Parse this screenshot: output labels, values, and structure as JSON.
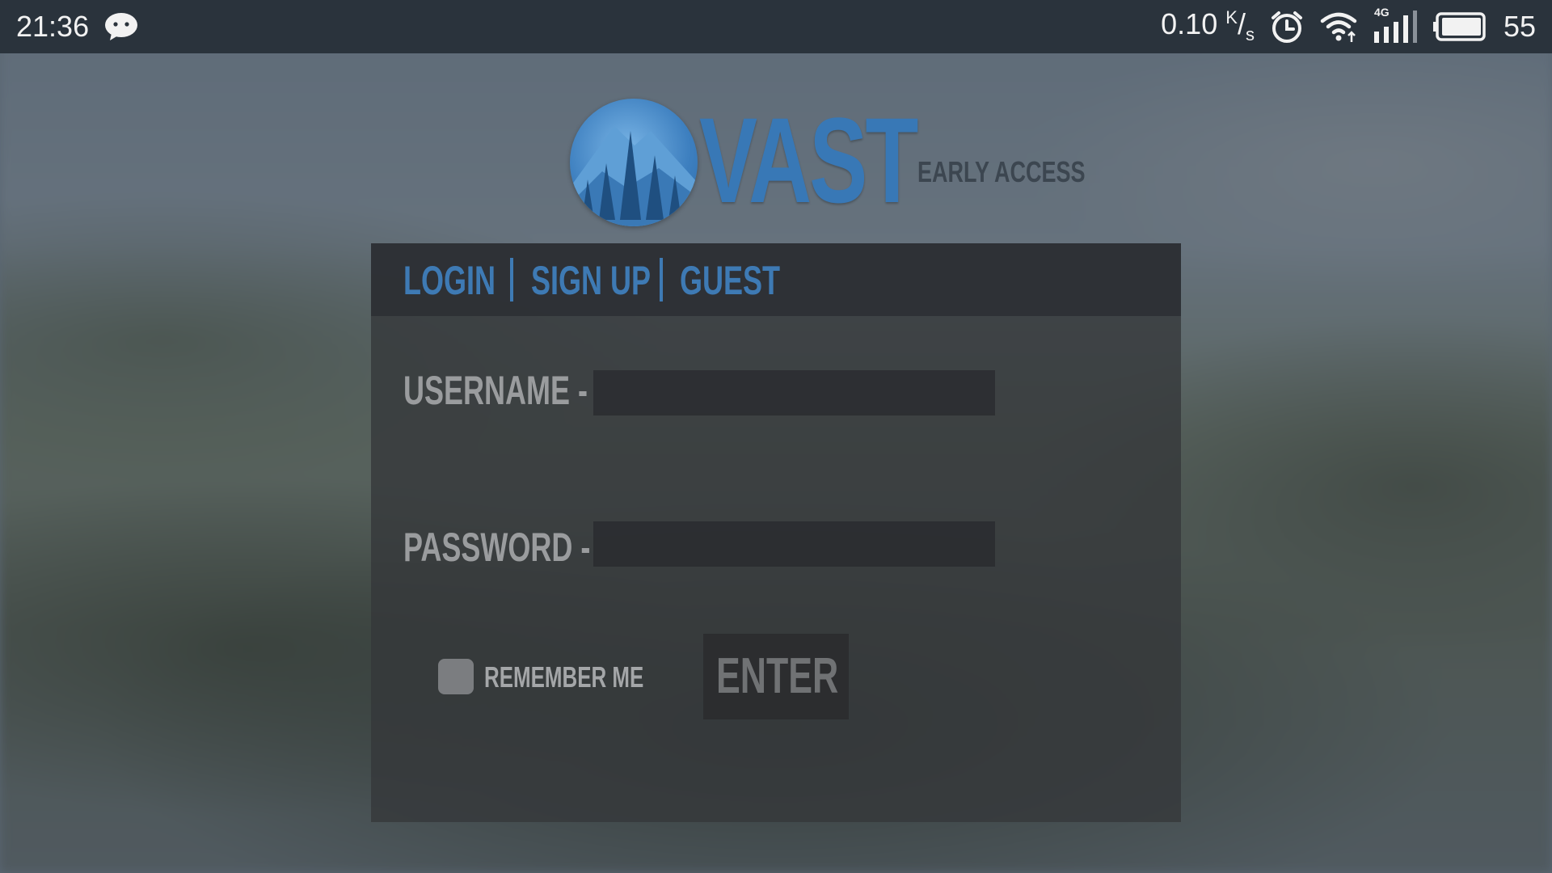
{
  "status_bar": {
    "time": "21:36",
    "chat_icon": "wechat-icon",
    "net_speed_value": "0.10",
    "net_speed_unit_top": "K",
    "net_speed_unit_bottom": "s",
    "alarm_icon": "alarm-clock-icon",
    "wifi_icon": "wifi-icon",
    "signal_label": "4G",
    "signal_icon": "cellular-signal-icon",
    "battery_icon": "battery-icon",
    "battery_level": "55"
  },
  "logo": {
    "emblem_icon": "mountain-forest-emblem-icon",
    "word": "VAST",
    "subtitle": "EARLY ACCESS"
  },
  "tabs": {
    "login": "LOGIN",
    "sign_up": "SIGN UP",
    "guest": "GUEST"
  },
  "form": {
    "username_label": "USERNAME -",
    "username_value": "",
    "password_label": "PASSWORD -",
    "password_value": "",
    "remember_label": "REMEMBER ME",
    "remember_checked": false,
    "enter_label": "ENTER"
  },
  "colors": {
    "accent": "#3e7ab4",
    "status_bar": "#2a333c",
    "panel": "#34373a"
  }
}
